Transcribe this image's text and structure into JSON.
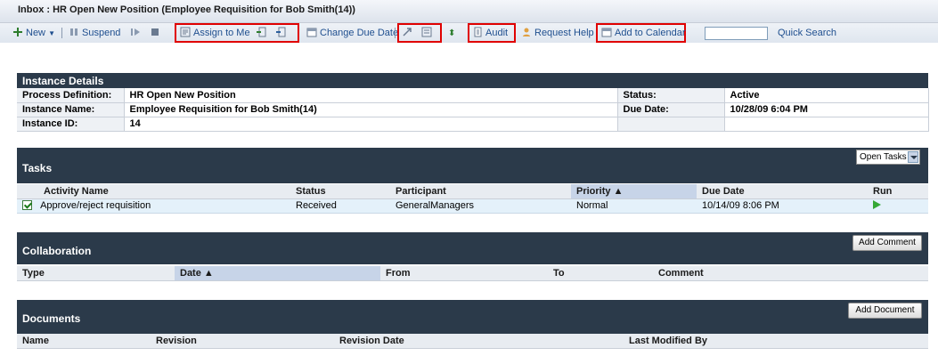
{
  "window": {
    "title": "Inbox : HR Open New Position (Employee Requisition for Bob Smith(14))"
  },
  "toolbar": {
    "new_label": "New",
    "suspend_label": "Suspend",
    "assign_label": "Assign to Me",
    "change_due_label": "Change Due Date",
    "audit_label": "Audit",
    "request_help_label": "Request Help",
    "add_calendar_label": "Add to Calendar",
    "quick_search_label": "Quick Search",
    "quick_search_value": ""
  },
  "instance_details": {
    "heading": "Instance Details",
    "process_definition_label": "Process Definition:",
    "process_definition_value": "HR Open New Position",
    "instance_name_label": "Instance Name:",
    "instance_name_value": "Employee Requisition for Bob Smith(14)",
    "instance_id_label": "Instance ID:",
    "instance_id_value": "14",
    "status_label": "Status:",
    "status_value": "Active",
    "due_date_label": "Due Date:",
    "due_date_value": "10/28/09 6:04 PM"
  },
  "tasks": {
    "heading": "Tasks",
    "filter_value": "Open Tasks",
    "columns": [
      "Activity Name",
      "Status",
      "Participant",
      "Priority ▲",
      "Due Date",
      "Run"
    ],
    "rows": [
      {
        "activity": "Approve/reject requisition",
        "status": "Received",
        "participant": "GeneralManagers",
        "priority": "Normal",
        "due": "10/14/09 8:06 PM"
      }
    ]
  },
  "collaboration": {
    "heading": "Collaboration",
    "add_button": "Add Comment",
    "columns": [
      "Type",
      "Date ▲",
      "From",
      "To",
      "Comment"
    ]
  },
  "documents": {
    "heading": "Documents",
    "add_button": "Add Document",
    "columns": [
      "Name",
      "Revision",
      "Revision Date",
      "Last Modified By"
    ]
  },
  "colors": {
    "panel_header": "#2b3a4a",
    "highlight": "#e00000",
    "link": "#1f4f8f"
  }
}
